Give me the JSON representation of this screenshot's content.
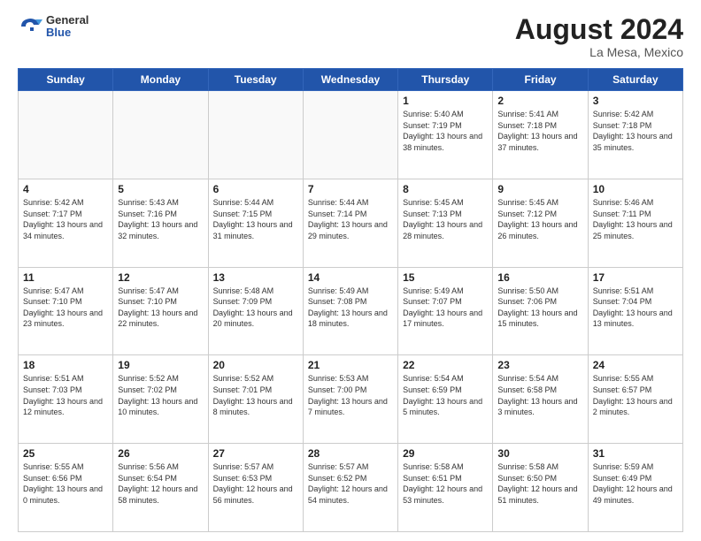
{
  "header": {
    "logo": {
      "general": "General",
      "blue": "Blue"
    },
    "title": "August 2024",
    "location": "La Mesa, Mexico"
  },
  "weekdays": [
    "Sunday",
    "Monday",
    "Tuesday",
    "Wednesday",
    "Thursday",
    "Friday",
    "Saturday"
  ],
  "weeks": [
    [
      {
        "day": "",
        "empty": true
      },
      {
        "day": "",
        "empty": true
      },
      {
        "day": "",
        "empty": true
      },
      {
        "day": "",
        "empty": true
      },
      {
        "day": "1",
        "sunrise": "5:40 AM",
        "sunset": "7:19 PM",
        "daylight": "13 hours and 38 minutes."
      },
      {
        "day": "2",
        "sunrise": "5:41 AM",
        "sunset": "7:18 PM",
        "daylight": "13 hours and 37 minutes."
      },
      {
        "day": "3",
        "sunrise": "5:42 AM",
        "sunset": "7:18 PM",
        "daylight": "13 hours and 35 minutes."
      }
    ],
    [
      {
        "day": "4",
        "sunrise": "5:42 AM",
        "sunset": "7:17 PM",
        "daylight": "13 hours and 34 minutes."
      },
      {
        "day": "5",
        "sunrise": "5:43 AM",
        "sunset": "7:16 PM",
        "daylight": "13 hours and 32 minutes."
      },
      {
        "day": "6",
        "sunrise": "5:44 AM",
        "sunset": "7:15 PM",
        "daylight": "13 hours and 31 minutes."
      },
      {
        "day": "7",
        "sunrise": "5:44 AM",
        "sunset": "7:14 PM",
        "daylight": "13 hours and 29 minutes."
      },
      {
        "day": "8",
        "sunrise": "5:45 AM",
        "sunset": "7:13 PM",
        "daylight": "13 hours and 28 minutes."
      },
      {
        "day": "9",
        "sunrise": "5:45 AM",
        "sunset": "7:12 PM",
        "daylight": "13 hours and 26 minutes."
      },
      {
        "day": "10",
        "sunrise": "5:46 AM",
        "sunset": "7:11 PM",
        "daylight": "13 hours and 25 minutes."
      }
    ],
    [
      {
        "day": "11",
        "sunrise": "5:47 AM",
        "sunset": "7:10 PM",
        "daylight": "13 hours and 23 minutes."
      },
      {
        "day": "12",
        "sunrise": "5:47 AM",
        "sunset": "7:10 PM",
        "daylight": "13 hours and 22 minutes."
      },
      {
        "day": "13",
        "sunrise": "5:48 AM",
        "sunset": "7:09 PM",
        "daylight": "13 hours and 20 minutes."
      },
      {
        "day": "14",
        "sunrise": "5:49 AM",
        "sunset": "7:08 PM",
        "daylight": "13 hours and 18 minutes."
      },
      {
        "day": "15",
        "sunrise": "5:49 AM",
        "sunset": "7:07 PM",
        "daylight": "13 hours and 17 minutes."
      },
      {
        "day": "16",
        "sunrise": "5:50 AM",
        "sunset": "7:06 PM",
        "daylight": "13 hours and 15 minutes."
      },
      {
        "day": "17",
        "sunrise": "5:51 AM",
        "sunset": "7:04 PM",
        "daylight": "13 hours and 13 minutes."
      }
    ],
    [
      {
        "day": "18",
        "sunrise": "5:51 AM",
        "sunset": "7:03 PM",
        "daylight": "13 hours and 12 minutes."
      },
      {
        "day": "19",
        "sunrise": "5:52 AM",
        "sunset": "7:02 PM",
        "daylight": "13 hours and 10 minutes."
      },
      {
        "day": "20",
        "sunrise": "5:52 AM",
        "sunset": "7:01 PM",
        "daylight": "13 hours and 8 minutes."
      },
      {
        "day": "21",
        "sunrise": "5:53 AM",
        "sunset": "7:00 PM",
        "daylight": "13 hours and 7 minutes."
      },
      {
        "day": "22",
        "sunrise": "5:54 AM",
        "sunset": "6:59 PM",
        "daylight": "13 hours and 5 minutes."
      },
      {
        "day": "23",
        "sunrise": "5:54 AM",
        "sunset": "6:58 PM",
        "daylight": "13 hours and 3 minutes."
      },
      {
        "day": "24",
        "sunrise": "5:55 AM",
        "sunset": "6:57 PM",
        "daylight": "13 hours and 2 minutes."
      }
    ],
    [
      {
        "day": "25",
        "sunrise": "5:55 AM",
        "sunset": "6:56 PM",
        "daylight": "13 hours and 0 minutes."
      },
      {
        "day": "26",
        "sunrise": "5:56 AM",
        "sunset": "6:54 PM",
        "daylight": "12 hours and 58 minutes."
      },
      {
        "day": "27",
        "sunrise": "5:57 AM",
        "sunset": "6:53 PM",
        "daylight": "12 hours and 56 minutes."
      },
      {
        "day": "28",
        "sunrise": "5:57 AM",
        "sunset": "6:52 PM",
        "daylight": "12 hours and 54 minutes."
      },
      {
        "day": "29",
        "sunrise": "5:58 AM",
        "sunset": "6:51 PM",
        "daylight": "12 hours and 53 minutes."
      },
      {
        "day": "30",
        "sunrise": "5:58 AM",
        "sunset": "6:50 PM",
        "daylight": "12 hours and 51 minutes."
      },
      {
        "day": "31",
        "sunrise": "5:59 AM",
        "sunset": "6:49 PM",
        "daylight": "12 hours and 49 minutes."
      }
    ]
  ]
}
